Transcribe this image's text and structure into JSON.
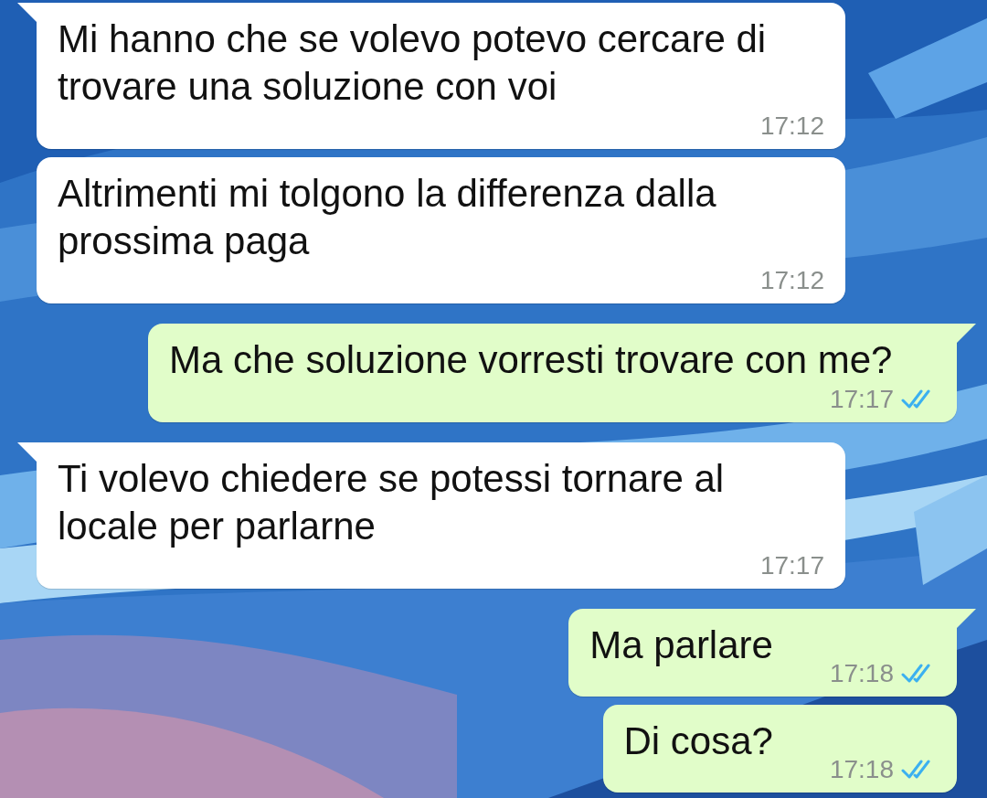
{
  "messages": [
    {
      "kind": "incoming",
      "tail": true,
      "text": "Mi hanno che se volevo potevo cercare di trovare una soluzione con voi",
      "time": "17:12"
    },
    {
      "kind": "incoming",
      "tail": false,
      "text": "Altrimenti mi tolgono la differenza dalla prossima paga",
      "time": "17:12"
    },
    {
      "kind": "outgoing",
      "tail": true,
      "text": "Ma che soluzione vorresti trovare con me?",
      "time": "17:17",
      "read": true
    },
    {
      "kind": "incoming",
      "tail": true,
      "text": "Ti volevo chiedere se potessi tornare al locale per parlarne",
      "time": "17:17"
    },
    {
      "kind": "outgoing",
      "tail": true,
      "text": "Ma parlare",
      "time": "17:18",
      "read": true
    },
    {
      "kind": "outgoing",
      "tail": false,
      "text": "Di cosa?",
      "time": "17:18",
      "read": true
    }
  ]
}
